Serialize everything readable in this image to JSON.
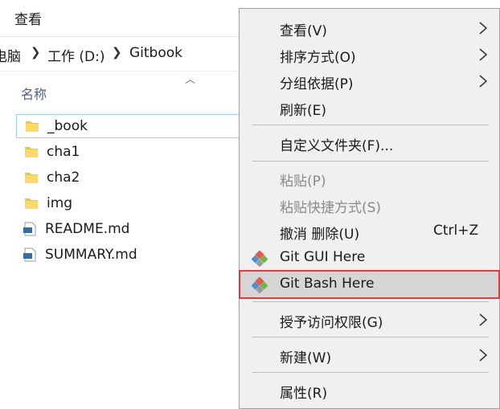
{
  "ribbon": {
    "tab_view": "查看"
  },
  "address": {
    "crumbs": [
      "电脑",
      "工作 (D:)",
      "Gitbook"
    ]
  },
  "list": {
    "column_name": "名称",
    "items": [
      {
        "name": "_book",
        "type": "folder"
      },
      {
        "name": "cha1",
        "type": "folder"
      },
      {
        "name": "cha2",
        "type": "folder"
      },
      {
        "name": "img",
        "type": "folder"
      },
      {
        "name": "README.md",
        "type": "md-file"
      },
      {
        "name": "SUMMARY.md",
        "type": "md-file"
      }
    ]
  },
  "menu": {
    "items": [
      {
        "label": "查看(V)",
        "submenu": true
      },
      {
        "label": "排序方式(O)",
        "submenu": true
      },
      {
        "label": "分组依据(P)",
        "submenu": true
      },
      {
        "label": "刷新(E)"
      },
      {
        "label": "自定义文件夹(F)..."
      },
      {
        "label": "粘贴(P)",
        "disabled": true
      },
      {
        "label": "粘贴快捷方式(S)",
        "disabled": true
      },
      {
        "label": "撤消 删除(U)",
        "shortcut": "Ctrl+Z"
      },
      {
        "label": "Git GUI Here",
        "icon": "git-icon"
      },
      {
        "label": "Git Bash Here",
        "icon": "git-icon",
        "highlighted": true
      },
      {
        "label": "授予访问权限(G)",
        "submenu": true
      },
      {
        "label": "新建(W)",
        "submenu": true
      },
      {
        "label": "属性(R)"
      }
    ]
  },
  "colors": {
    "menu_bg": "#f0f0f0",
    "highlight_bg": "#d6d6d6",
    "highlight_border": "#e03c3c",
    "folder": "#f3c33c",
    "disabled_text": "#8a8a8a"
  }
}
